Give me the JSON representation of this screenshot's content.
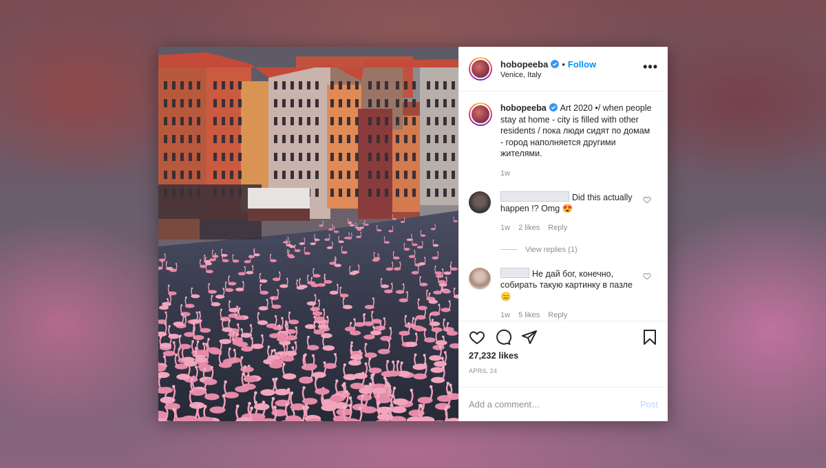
{
  "post": {
    "username": "hobopeeba",
    "follow_label": "Follow",
    "location": "Venice, Italy",
    "more_label": "•••"
  },
  "caption": {
    "username": "hobopeeba",
    "text": "Art 2020 •/ when people stay at home - city is filled with other residents / пока люди сидят по домам - город наполняется другими жителями.",
    "time": "1w"
  },
  "comments": [
    {
      "text": "Did this actually happen !? Omg 😍",
      "time": "1w",
      "likes": "2 likes",
      "reply_label": "Reply",
      "view_replies": "View replies (1)"
    },
    {
      "text": "Не дай бог, конечно, собирать такую картинку в пазлe😑",
      "time": "1w",
      "likes": "5 likes",
      "reply_label": "Reply"
    }
  ],
  "footer": {
    "likes": "27,232 likes",
    "date": "APRIL 24",
    "comment_placeholder": "Add a comment…",
    "post_label": "Post"
  },
  "icons": {
    "verified": "verified-badge-icon",
    "like": "heart-icon",
    "comment": "comment-icon",
    "share": "paper-plane-icon",
    "save": "bookmark-icon"
  },
  "colors": {
    "link": "#0095f6",
    "post_disabled": "#b3dbff",
    "muted": "#8e8e8e"
  }
}
